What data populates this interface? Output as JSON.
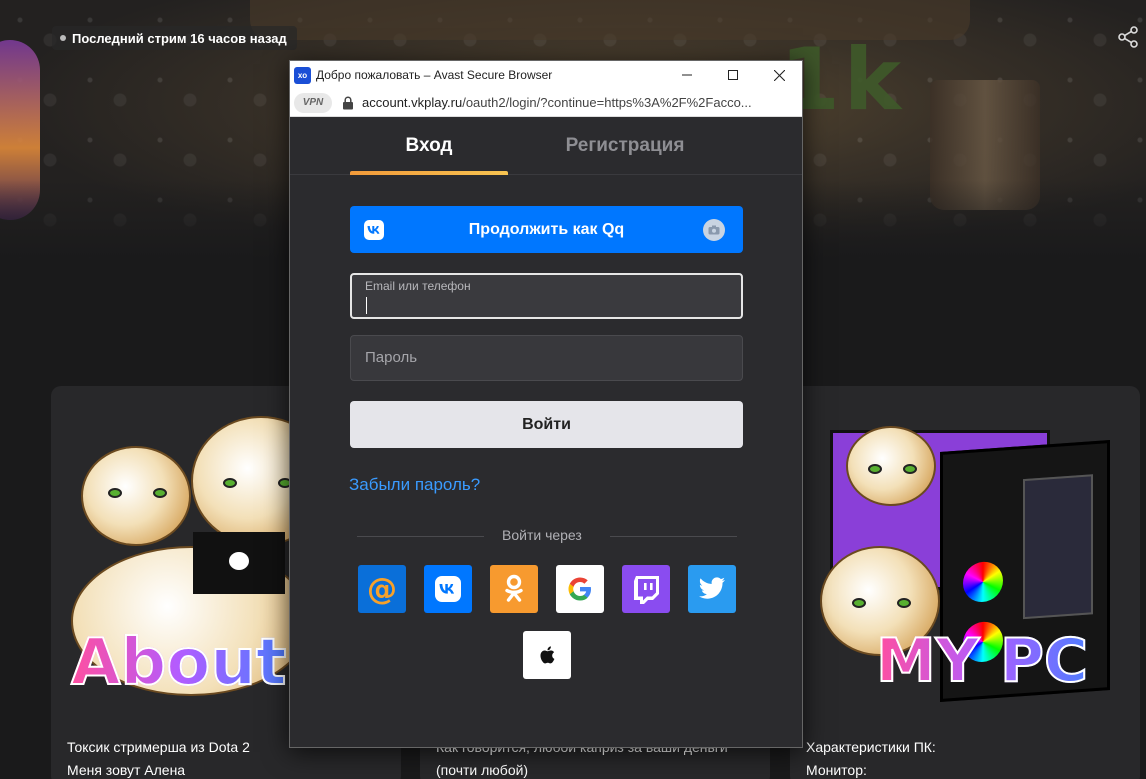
{
  "background": {
    "stream_badge": "Последний стрим 16 часов назад",
    "banner_letters": "1k",
    "cards": [
      {
        "art_text": "About",
        "title_line1": "Токсик стримерша из Dota 2",
        "title_line2": "Меня зовут Алена"
      },
      {
        "art_text": "",
        "title_line1": "Как говорится, любой каприз за ваши деньги",
        "title_line2": "(почти любой)"
      },
      {
        "art_text": "MY PC",
        "title_line1": "Характеристики ПК:",
        "title_line2": "Монитор:"
      }
    ]
  },
  "window": {
    "app_icon_text": "xo",
    "title": "Добро пожаловать – Avast Secure Browser",
    "vpn_label": "VPN",
    "url_host": "account.vkplay.ru",
    "url_rest": "/oauth2/login/?continue=https%3A%2F%2Facco..."
  },
  "tabs": {
    "login": "Вход",
    "register": "Регистрация"
  },
  "form": {
    "vk_continue": "Продолжить как Qq",
    "email_label": "Email или телефон",
    "password_placeholder": "Пароль",
    "login_button": "Войти",
    "forgot": "Забыли пароль?",
    "login_via": "Войти через"
  },
  "colors": {
    "accent_blue": "#0077ff",
    "tab_underline": "#f29a3a",
    "link": "#3a9bff",
    "panel_bg": "#2b2b2e"
  },
  "social_icons": [
    "mail-ru-icon",
    "vk-icon",
    "odnoklassniki-icon",
    "google-icon",
    "twitch-icon",
    "twitter-icon",
    "apple-icon"
  ]
}
